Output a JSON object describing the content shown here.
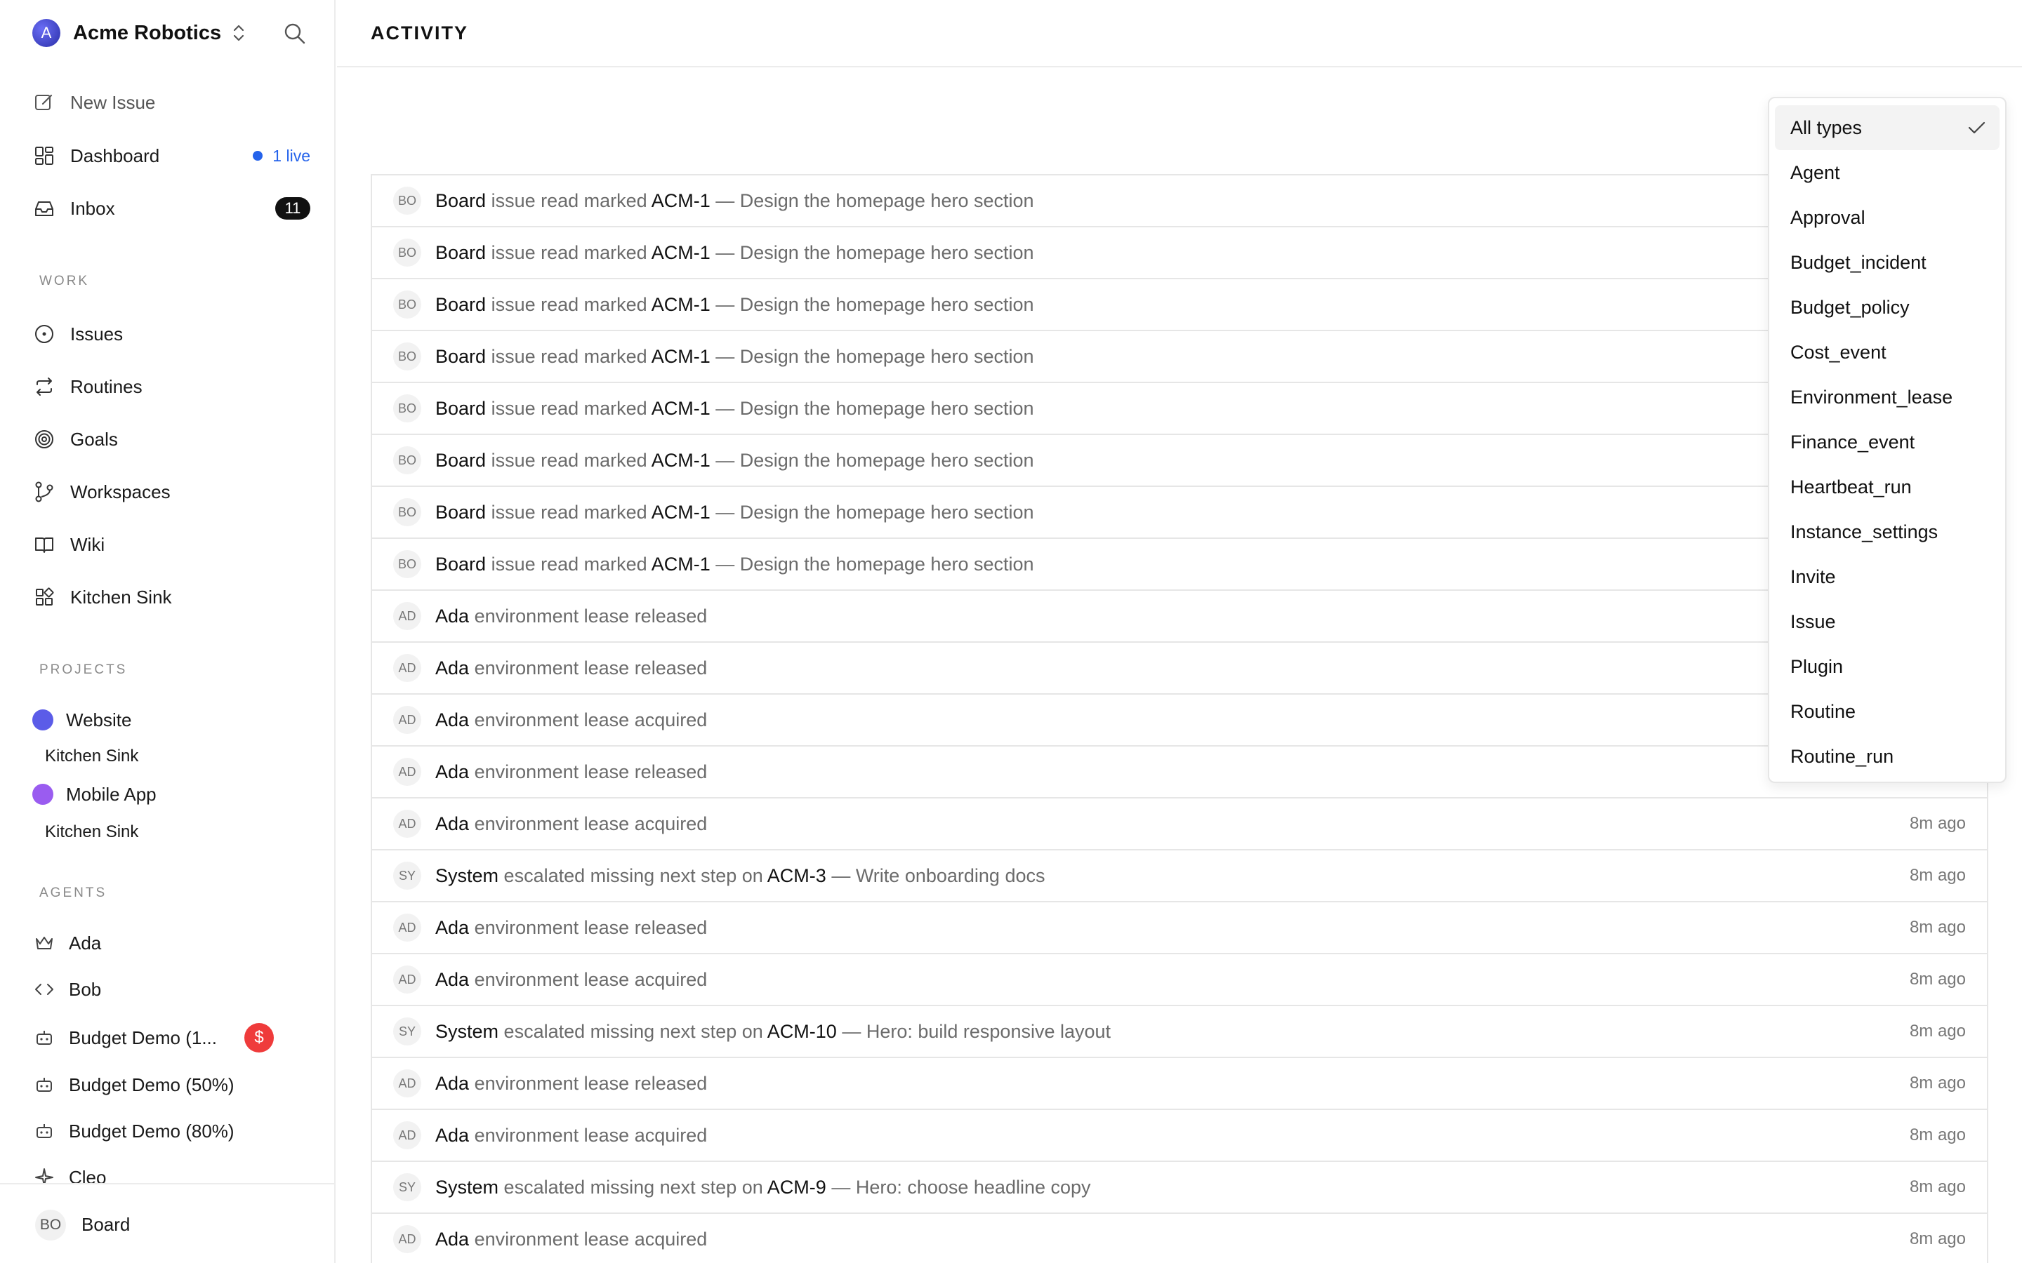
{
  "company": {
    "name": "Acme Robotics",
    "logo_letter": "A"
  },
  "nav": {
    "new_issue": "New Issue",
    "dashboard": "Dashboard",
    "dashboard_live": "1 live",
    "inbox": "Inbox",
    "inbox_count": "11"
  },
  "sections": {
    "work": "WORK",
    "projects": "PROJECTS",
    "agents": "AGENTS"
  },
  "work": [
    "Issues",
    "Routines",
    "Goals",
    "Workspaces",
    "Wiki",
    "Kitchen Sink"
  ],
  "projects": [
    {
      "name": "Website",
      "color": "#5b5ce8",
      "sub": "Kitchen Sink"
    },
    {
      "name": "Mobile App",
      "color": "#9a5cf0",
      "sub": "Kitchen Sink"
    }
  ],
  "agents": [
    "Ada",
    "Bob",
    "Budget Demo (1...",
    "Budget Demo (50%)",
    "Budget Demo (80%)",
    "Cleo"
  ],
  "agent_alert_icon": "$",
  "user": {
    "initials": "BO",
    "name": "Board"
  },
  "page": {
    "title": "ACTIVITY"
  },
  "filter": {
    "selected": "All types",
    "options": [
      "All types",
      "Agent",
      "Approval",
      "Budget_incident",
      "Budget_policy",
      "Cost_event",
      "Environment_lease",
      "Finance_event",
      "Heartbeat_run",
      "Instance_settings",
      "Invite",
      "Issue",
      "Plugin",
      "Routine",
      "Routine_run"
    ]
  },
  "activity": [
    {
      "initials": "BO",
      "actor": "Board",
      "action": "issue read marked",
      "issue": "ACM-1",
      "title": "— Design the homepage hero section",
      "time": ""
    },
    {
      "initials": "BO",
      "actor": "Board",
      "action": "issue read marked",
      "issue": "ACM-1",
      "title": "— Design the homepage hero section",
      "time": ""
    },
    {
      "initials": "BO",
      "actor": "Board",
      "action": "issue read marked",
      "issue": "ACM-1",
      "title": "— Design the homepage hero section",
      "time": ""
    },
    {
      "initials": "BO",
      "actor": "Board",
      "action": "issue read marked",
      "issue": "ACM-1",
      "title": "— Design the homepage hero section",
      "time": ""
    },
    {
      "initials": "BO",
      "actor": "Board",
      "action": "issue read marked",
      "issue": "ACM-1",
      "title": "— Design the homepage hero section",
      "time": ""
    },
    {
      "initials": "BO",
      "actor": "Board",
      "action": "issue read marked",
      "issue": "ACM-1",
      "title": "— Design the homepage hero section",
      "time": ""
    },
    {
      "initials": "BO",
      "actor": "Board",
      "action": "issue read marked",
      "issue": "ACM-1",
      "title": "— Design the homepage hero section",
      "time": ""
    },
    {
      "initials": "BO",
      "actor": "Board",
      "action": "issue read marked",
      "issue": "ACM-1",
      "title": "— Design the homepage hero section",
      "time": ""
    },
    {
      "initials": "AD",
      "actor": "Ada",
      "action": "environment lease released",
      "issue": "",
      "title": "",
      "time": ""
    },
    {
      "initials": "AD",
      "actor": "Ada",
      "action": "environment lease released",
      "issue": "",
      "title": "",
      "time": ""
    },
    {
      "initials": "AD",
      "actor": "Ada",
      "action": "environment lease acquired",
      "issue": "",
      "title": "",
      "time": ""
    },
    {
      "initials": "AD",
      "actor": "Ada",
      "action": "environment lease released",
      "issue": "",
      "title": "",
      "time": ""
    },
    {
      "initials": "AD",
      "actor": "Ada",
      "action": "environment lease acquired",
      "issue": "",
      "title": "",
      "time": "8m ago"
    },
    {
      "initials": "SY",
      "actor": "System",
      "action": "escalated missing next step on",
      "issue": "ACM-3",
      "title": "— Write onboarding docs",
      "time": "8m ago"
    },
    {
      "initials": "AD",
      "actor": "Ada",
      "action": "environment lease released",
      "issue": "",
      "title": "",
      "time": "8m ago"
    },
    {
      "initials": "AD",
      "actor": "Ada",
      "action": "environment lease acquired",
      "issue": "",
      "title": "",
      "time": "8m ago"
    },
    {
      "initials": "SY",
      "actor": "System",
      "action": "escalated missing next step on",
      "issue": "ACM-10",
      "title": "— Hero: build responsive layout",
      "time": "8m ago"
    },
    {
      "initials": "AD",
      "actor": "Ada",
      "action": "environment lease released",
      "issue": "",
      "title": "",
      "time": "8m ago"
    },
    {
      "initials": "AD",
      "actor": "Ada",
      "action": "environment lease acquired",
      "issue": "",
      "title": "",
      "time": "8m ago"
    },
    {
      "initials": "SY",
      "actor": "System",
      "action": "escalated missing next step on",
      "issue": "ACM-9",
      "title": "— Hero: choose headline copy",
      "time": "8m ago"
    },
    {
      "initials": "AD",
      "actor": "Ada",
      "action": "environment lease acquired",
      "issue": "",
      "title": "",
      "time": "8m ago"
    }
  ]
}
